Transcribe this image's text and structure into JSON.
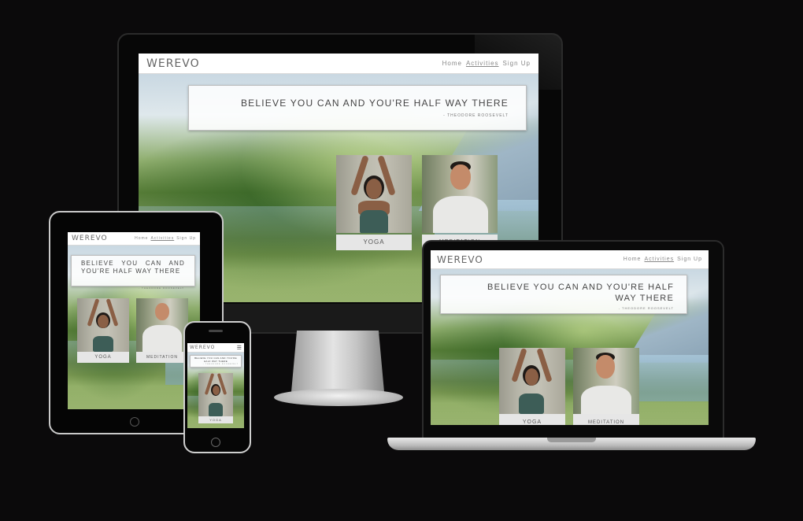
{
  "site": {
    "brand": "WEREVO",
    "nav": [
      "Home",
      "Activities",
      "Sign Up"
    ],
    "active_nav": "Activities",
    "quote": "BELIEVE YOU CAN AND YOU'RE HALF WAY THERE",
    "attribution": "- THEODORE ROOSEVELT",
    "cards": [
      {
        "label": "YOGA",
        "photo": "woman-yoga-pose-photo"
      },
      {
        "label": "MEDITATION",
        "photo": "man-meditating-photo"
      }
    ],
    "menu_icon": "hamburger-menu-icon"
  },
  "devices": [
    "desktop-monitor",
    "tablet",
    "laptop",
    "phone"
  ],
  "colors": {
    "page_background": "#0b0a0b",
    "navbar_background": "#ffffff",
    "text": "#666666",
    "label_background": "#e6e6e6"
  }
}
